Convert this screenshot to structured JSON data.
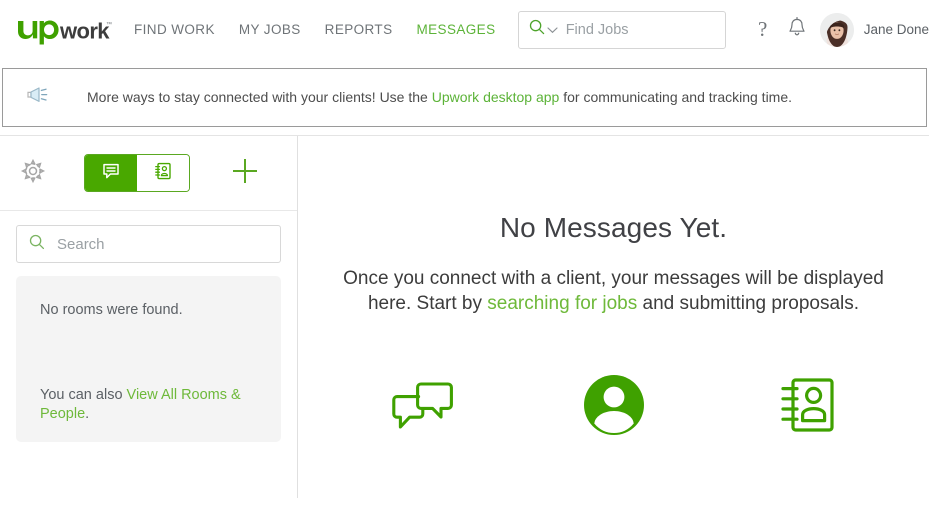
{
  "brand": {
    "logo_text_1": "Up",
    "logo_text_2": "work",
    "trademark": "™",
    "green": "#3fa100",
    "nav_green": "#5cb338",
    "link_green": "#6eb93a"
  },
  "header": {
    "nav": [
      {
        "label": "FIND WORK",
        "active": false
      },
      {
        "label": "MY JOBS",
        "active": false
      },
      {
        "label": "REPORTS",
        "active": false
      },
      {
        "label": "MESSAGES",
        "active": true
      }
    ],
    "search": {
      "placeholder": "Find Jobs",
      "value": "",
      "icon": "search-icon",
      "dropdown_icon": "chevron-down-icon"
    },
    "help_label": "?",
    "notifications_icon": "bell-icon",
    "user": {
      "name": "Jane Done",
      "avatar_icon": "user-avatar"
    }
  },
  "banner": {
    "icon": "megaphone-icon",
    "text_before": "More ways to stay connected with your clients! Use the ",
    "link_text": "Upwork desktop app",
    "text_after": " for communicating and tracking time."
  },
  "sidebar": {
    "toolbar": {
      "settings_icon": "gear-icon",
      "toggle": [
        {
          "name": "messages",
          "icon": "chat-bubble-icon",
          "active": true
        },
        {
          "name": "contacts",
          "icon": "address-book-icon",
          "active": false
        }
      ],
      "add_icon": "plus-icon",
      "add_label": "+"
    },
    "search": {
      "placeholder": "Search",
      "value": "",
      "icon": "search-icon"
    },
    "rooms": {
      "empty_text": "No rooms were found.",
      "also_prefix": "You can also ",
      "also_link": "View All Rooms & People",
      "also_suffix": "."
    }
  },
  "main": {
    "title": "No Messages Yet.",
    "description_before": "Once you connect with a client, your messages will be displayed here. Start by ",
    "description_link": "searching for jobs",
    "description_after": " and submitting proposals.",
    "icons": [
      {
        "name": "chat-bubbles-icon"
      },
      {
        "name": "person-circle-icon"
      },
      {
        "name": "address-book-icon"
      }
    ]
  }
}
